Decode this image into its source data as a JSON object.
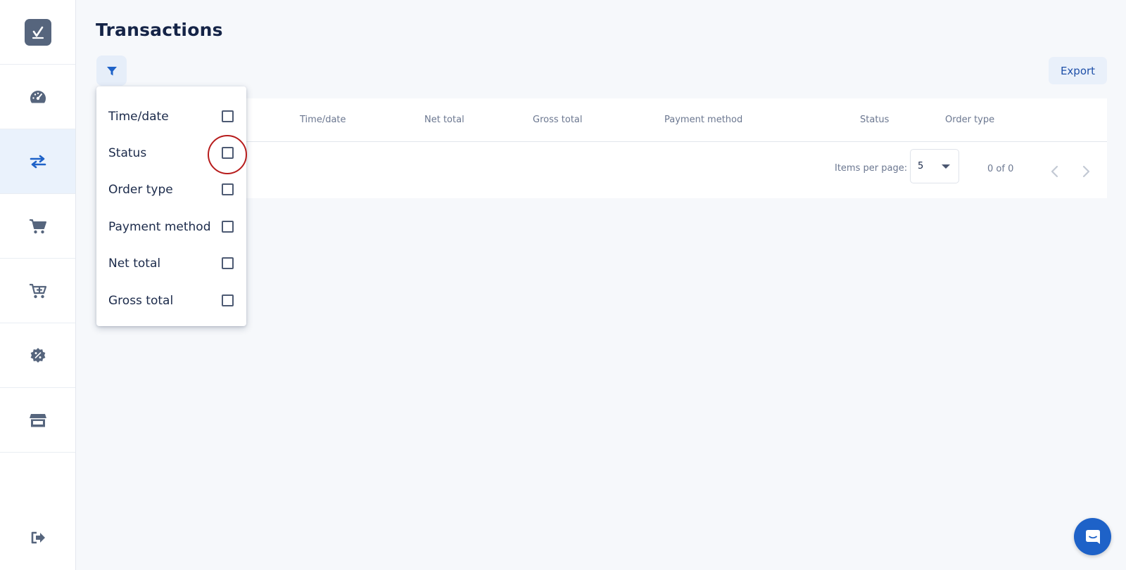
{
  "page": {
    "title": "Transactions"
  },
  "toolbar": {
    "export_label": "Export"
  },
  "table": {
    "columns": [
      "Time/date",
      "Net total",
      "Gross total",
      "Payment method",
      "Status",
      "Order type"
    ]
  },
  "paginator": {
    "items_per_page_label": "Items per page:",
    "items_per_page_value": "5",
    "range_label": "0 of 0"
  },
  "column_filter": {
    "items": [
      {
        "label": "Time/date",
        "checked": false
      },
      {
        "label": "Status",
        "checked": false
      },
      {
        "label": "Order type",
        "checked": false
      },
      {
        "label": "Payment method",
        "checked": false
      },
      {
        "label": "Net total",
        "checked": false
      },
      {
        "label": "Gross total",
        "checked": false
      }
    ]
  },
  "sidebar": {
    "items": [
      {
        "icon": "speedometer-icon"
      },
      {
        "icon": "swap-arrows-icon",
        "active": true
      },
      {
        "icon": "cart-icon"
      },
      {
        "icon": "cart-plus-icon"
      },
      {
        "icon": "discount-badge-icon"
      },
      {
        "icon": "store-icon"
      }
    ],
    "bottom_icon": "logout-icon"
  },
  "colors": {
    "accent": "#1e62c8",
    "sidebar_active_bg": "#eaf2fc",
    "icon_gray": "#56657d",
    "highlight_ring": "#b71c1c"
  }
}
